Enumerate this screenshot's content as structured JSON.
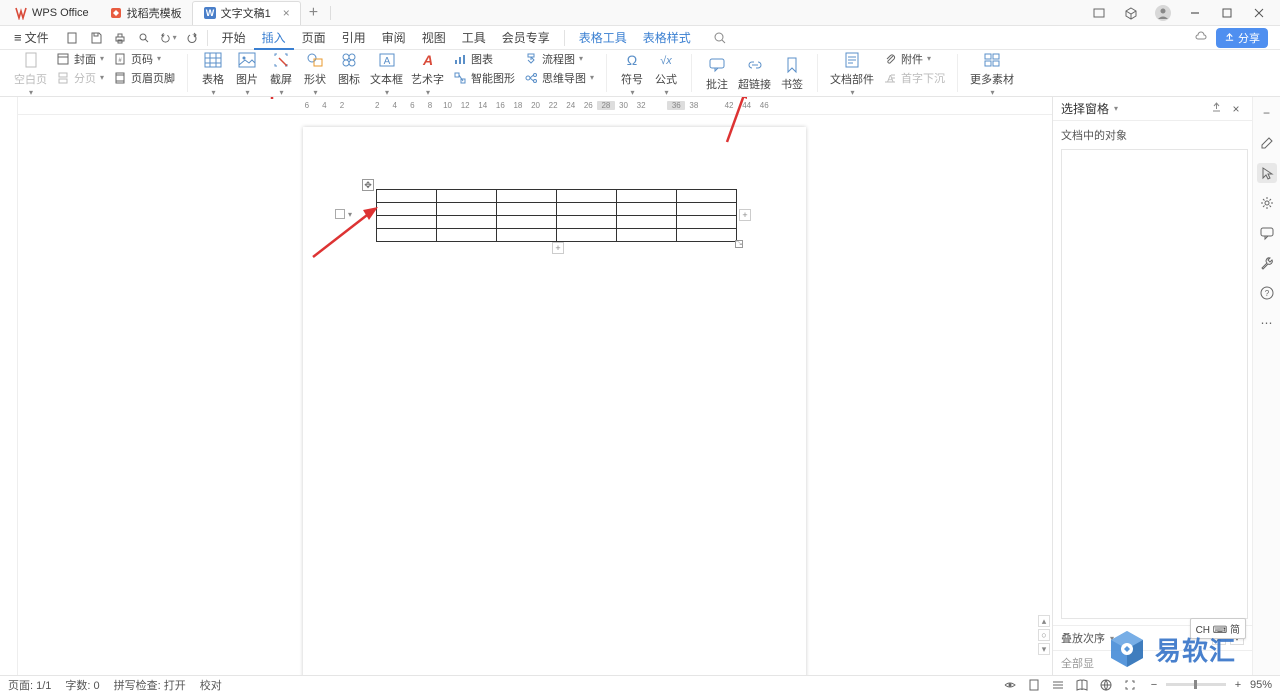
{
  "titlebar": {
    "app_name": "WPS Office",
    "tabs": [
      {
        "label": "找稻壳模板",
        "type": "template"
      },
      {
        "label": "文字文稿1",
        "type": "doc",
        "active": true
      }
    ]
  },
  "menubar": {
    "file": "文件",
    "items": [
      "开始",
      "插入",
      "页面",
      "引用",
      "审阅",
      "视图",
      "工具",
      "会员专享",
      "表格工具",
      "表格样式"
    ],
    "active_index": 1,
    "blue_from_index": 8,
    "share": "分享"
  },
  "ribbon": {
    "blank_page": "空白页",
    "cover": "封面",
    "break": "分页",
    "page_number": "页码",
    "header_footer": "页眉页脚",
    "table": "表格",
    "picture": "图片",
    "screenshot": "截屏",
    "shape": "形状",
    "icon": "图标",
    "textbox": "文本框",
    "wordart": "艺术字",
    "chart": "图表",
    "smartart": "智能图形",
    "mindmap": "思维导图",
    "flowchart": "流程图",
    "symbol": "符号",
    "equation": "公式",
    "comment": "批注",
    "hyperlink": "超链接",
    "bookmark": "书签",
    "doc_parts": "文档部件",
    "attachment": "附件",
    "dropcap": "首字下沉",
    "more_material": "更多素材"
  },
  "ruler_ticks": [
    "6",
    "4",
    "2",
    "",
    "2",
    "4",
    "6",
    "8",
    "10",
    "12",
    "14",
    "16",
    "18",
    "20",
    "22",
    "24",
    "26",
    "28",
    "30",
    "32",
    "",
    "36",
    "38",
    "",
    "42",
    "44",
    "46"
  ],
  "panel": {
    "title": "选择窗格",
    "subtitle": "文档中的对象",
    "stack_order": "叠放次序",
    "all_show": "全部显"
  },
  "status": {
    "page": "页面: 1/1",
    "words": "字数: 0",
    "spell": "拼写检查: 打开",
    "proof": "校对",
    "zoom": "95%"
  },
  "ime": "CH ⌨ 简",
  "watermark_text": "易软汇"
}
